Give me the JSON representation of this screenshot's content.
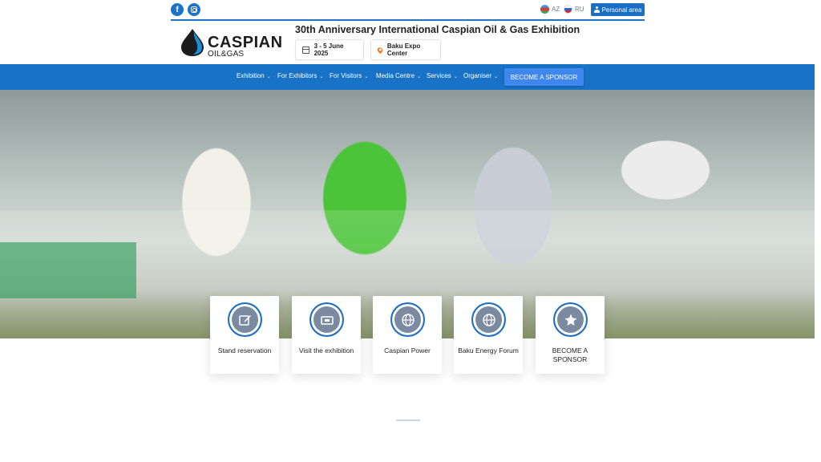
{
  "topbar": {
    "social": [
      {
        "name": "facebook",
        "glyph": "f"
      },
      {
        "name": "instagram"
      }
    ],
    "languages": [
      {
        "code": "AZ"
      },
      {
        "code": "RU"
      }
    ],
    "personal_area_label": "Personal area"
  },
  "header": {
    "logo": {
      "main": "CASPIAN",
      "sub": "OIL&GAS"
    },
    "headline": "30th Anniversary International Caspian Oil & Gas Exhibition",
    "date": "3 - 5 June 2025",
    "venue": "Baku Expo Center"
  },
  "nav": {
    "items": [
      {
        "label": "Exhibition"
      },
      {
        "label": "For Exhibitors"
      },
      {
        "label": "For Visitors"
      },
      {
        "label": "Media Centre"
      },
      {
        "label": "Services"
      },
      {
        "label": "Organiser"
      }
    ],
    "cta": "BECOME A SPONSOR"
  },
  "cards": [
    {
      "label": "Stand reservation",
      "icon": "edit-icon"
    },
    {
      "label": "Visit the exhibition",
      "icon": "ticket-icon"
    },
    {
      "label": "Caspian Power",
      "icon": "globe-icon"
    },
    {
      "label": "Baku Energy Forum",
      "icon": "globe-icon"
    },
    {
      "label": "BECOME A SPONSOR",
      "icon": "star-icon"
    }
  ],
  "colors": {
    "brand_blue": "#1873c6",
    "cta_blue": "#3f86ee",
    "icon_fill": "#7b8aa0"
  }
}
